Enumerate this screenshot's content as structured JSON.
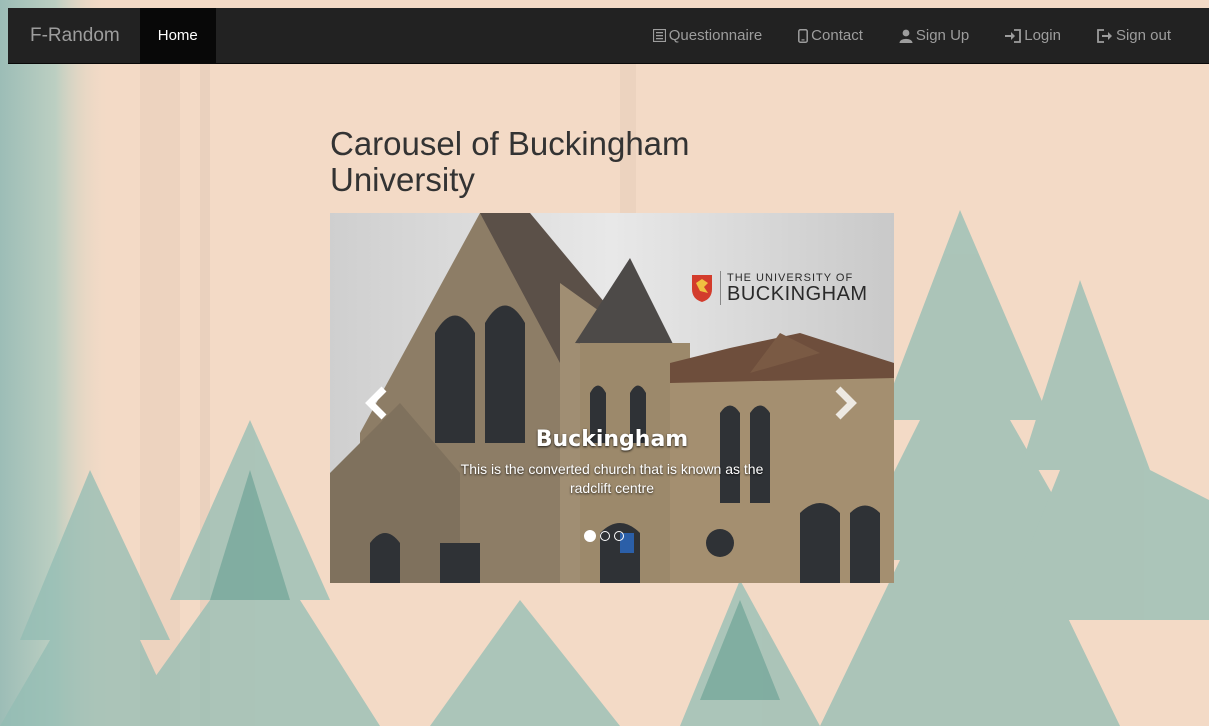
{
  "navbar": {
    "brand": "F-Random",
    "home": "Home",
    "items": [
      {
        "label": "Questionnaire",
        "icon": "list-alt-icon"
      },
      {
        "label": "Contact",
        "icon": "phone-icon"
      },
      {
        "label": "Sign Up",
        "icon": "user-icon"
      },
      {
        "label": "Login",
        "icon": "login-icon"
      },
      {
        "label": "Sign out",
        "icon": "logout-icon"
      }
    ]
  },
  "main": {
    "title": "Carousel of Buckingham University"
  },
  "carousel": {
    "logo_line1": "THE UNIVERSITY OF",
    "logo_line2": "BUCKINGHAM",
    "caption_title": "Buckingham",
    "caption_text": "This is the converted church that is known as the radclift centre",
    "slide_count": 3,
    "active_slide": 1
  },
  "colors": {
    "navbar_bg": "#222222",
    "navbar_active": "#080808",
    "nav_text": "#9d9d9d",
    "page_bg": "#f3d9c4",
    "trees": "#8fb8b0"
  }
}
